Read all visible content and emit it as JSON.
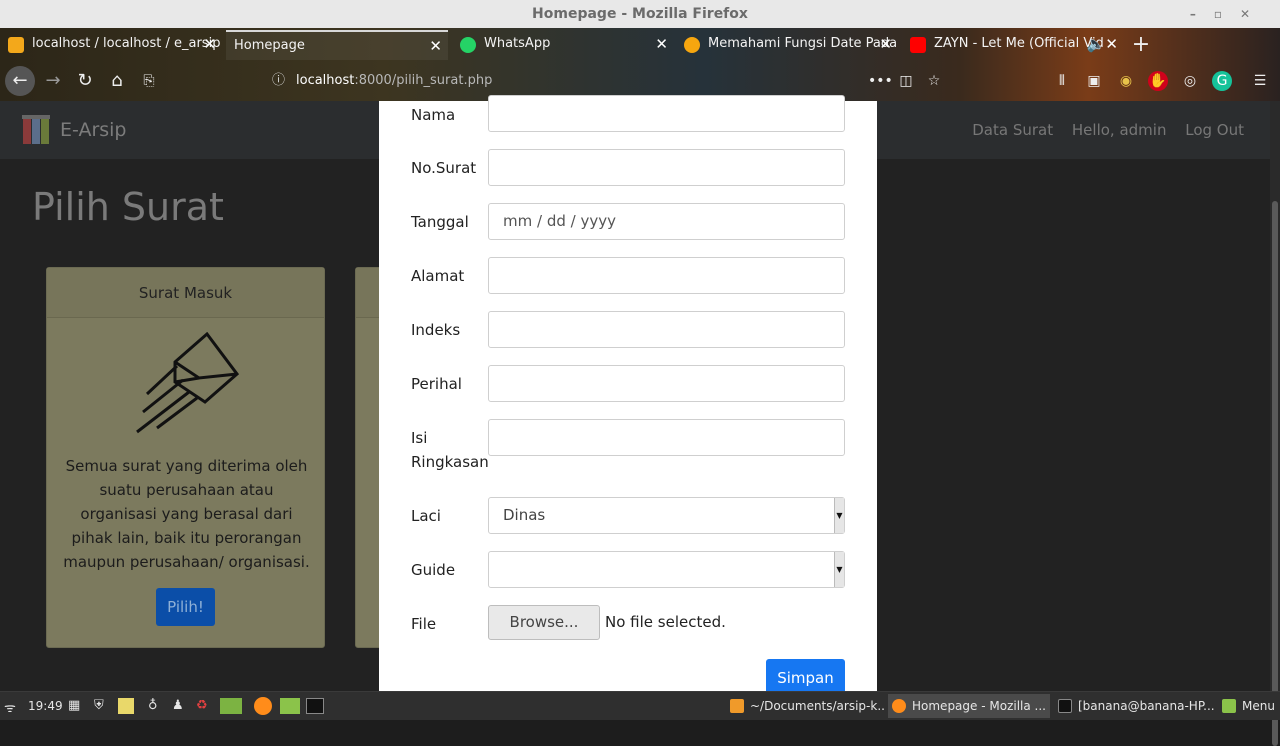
{
  "window": {
    "title": "Homepage - Mozilla Firefox"
  },
  "tabs": [
    {
      "label": "localhost / localhost / e_arsip",
      "fav_color": "#f3a81b"
    },
    {
      "label": "Homepage",
      "fav_color": "transparent"
    },
    {
      "label": "WhatsApp",
      "fav_color": "#25d366"
    },
    {
      "label": "Memahami Fungsi Date Pada",
      "fav_color": "#f6a60f"
    },
    {
      "label": "ZAYN - Let Me (Official Vid",
      "fav_color": "#ff0000"
    }
  ],
  "url": {
    "host": "localhost",
    "path": ":8000/pilih_surat.php"
  },
  "site": {
    "brand": "E-Arsip",
    "nav": [
      "Data Surat",
      "Hello, admin",
      "Log Out"
    ],
    "heading": "Pilih Surat",
    "card": {
      "title": "Surat Masuk",
      "text": "Semua surat yang diterima oleh suatu perusahaan atau organisasi yang berasal dari pihak lain, baik itu perorangan maupun perusahaan/ organisasi.",
      "button": "Pilih!"
    }
  },
  "form": {
    "nama_label": "Nama",
    "nosurat_label": "No.Surat",
    "tanggal_label": "Tanggal",
    "tanggal_placeholder": "mm / dd / yyyy",
    "alamat_label": "Alamat",
    "indeks_label": "Indeks",
    "perihal_label": "Perihal",
    "isi_label_1": "Isi",
    "isi_label_2": "Ringkasan",
    "laci_label": "Laci",
    "laci_value": "Dinas",
    "guide_label": "Guide",
    "guide_value": "",
    "file_label": "File",
    "browse_label": "Browse...",
    "nofile_text": "No file selected.",
    "submit_label": "Simpan"
  },
  "taskbar": {
    "time": "19:49",
    "menu": "Menu",
    "tasks": [
      "~/Documents/arsip-k...",
      "Homepage - Mozilla ...",
      "[banana@banana-HP..."
    ]
  }
}
